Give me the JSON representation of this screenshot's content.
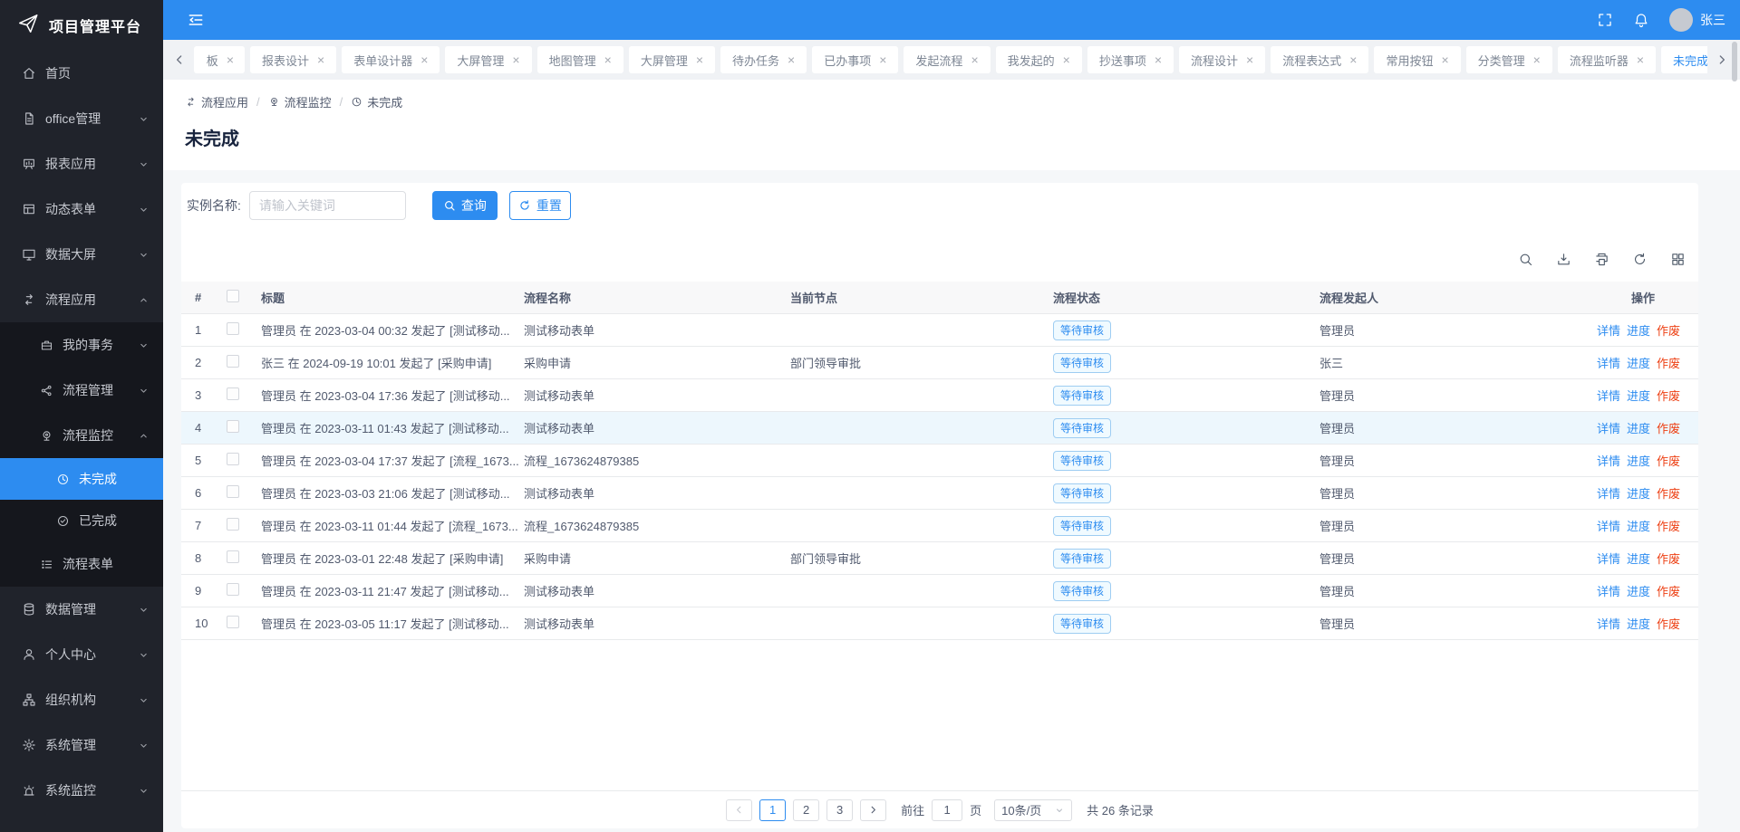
{
  "sidebar": {
    "logo": "项目管理平台",
    "items": [
      {
        "id": "home",
        "label": "首页",
        "icon": "home"
      },
      {
        "id": "office",
        "label": "office管理",
        "icon": "file",
        "chevron": "down"
      },
      {
        "id": "report-app",
        "label": "报表应用",
        "icon": "report",
        "chevron": "down"
      },
      {
        "id": "dynamic-form",
        "label": "动态表单",
        "icon": "form",
        "chevron": "down"
      },
      {
        "id": "data-screen",
        "label": "数据大屏",
        "icon": "screen",
        "chevron": "down"
      },
      {
        "id": "flow-app",
        "label": "流程应用",
        "icon": "flow",
        "chevron": "up",
        "children": [
          {
            "id": "my-tasks",
            "label": "我的事务",
            "icon": "briefcase",
            "chevron": "down"
          },
          {
            "id": "flow-manage",
            "label": "流程管理",
            "icon": "share",
            "chevron": "down"
          },
          {
            "id": "flow-monitor",
            "label": "流程监控",
            "icon": "camera",
            "chevron": "up",
            "children": [
              {
                "id": "unfinished",
                "label": "未完成",
                "icon": "clock",
                "active": true
              },
              {
                "id": "finished",
                "label": "已完成",
                "icon": "check"
              }
            ]
          },
          {
            "id": "flow-form",
            "label": "流程表单",
            "icon": "list"
          }
        ]
      },
      {
        "id": "data-manage",
        "label": "数据管理",
        "icon": "database",
        "chevron": "down"
      },
      {
        "id": "personal-center",
        "label": "个人中心",
        "icon": "user",
        "chevron": "down"
      },
      {
        "id": "organization",
        "label": "组织机构",
        "icon": "org",
        "chevron": "down"
      },
      {
        "id": "sys-manage",
        "label": "系统管理",
        "icon": "gear",
        "chevron": "down"
      },
      {
        "id": "sys-monitor",
        "label": "系统监控",
        "icon": "alarm",
        "chevron": "down"
      }
    ]
  },
  "header": {
    "username": "张三"
  },
  "tabs": {
    "items": [
      {
        "label": "板",
        "partial": true
      },
      {
        "label": "报表设计"
      },
      {
        "label": "表单设计器"
      },
      {
        "label": "大屏管理"
      },
      {
        "label": "地图管理"
      },
      {
        "label": "大屏管理"
      },
      {
        "label": "待办任务"
      },
      {
        "label": "已办事项"
      },
      {
        "label": "发起流程"
      },
      {
        "label": "我发起的"
      },
      {
        "label": "抄送事项"
      },
      {
        "label": "流程设计"
      },
      {
        "label": "流程表达式"
      },
      {
        "label": "常用按钮"
      },
      {
        "label": "分类管理"
      },
      {
        "label": "流程监听器"
      },
      {
        "label": "未完成",
        "active": true
      }
    ]
  },
  "breadcrumb": {
    "items": [
      {
        "label": "流程应用",
        "icon": "flow"
      },
      {
        "label": "流程监控",
        "icon": "camera"
      },
      {
        "label": "未完成",
        "icon": "clock"
      }
    ]
  },
  "page": {
    "title": "未完成"
  },
  "search": {
    "label": "实例名称:",
    "placeholder": "请输入关键词",
    "query_label": "查询",
    "reset_label": "重置"
  },
  "toolbar": {
    "icons": [
      "search",
      "download",
      "printer",
      "refresh",
      "grid"
    ]
  },
  "table": {
    "columns": [
      "#",
      "标题",
      "流程名称",
      "当前节点",
      "流程状态",
      "流程发起人",
      "操作"
    ],
    "action_labels": [
      "详情",
      "进度",
      "作废"
    ],
    "rows": [
      {
        "index": "1",
        "title": "管理员 在 2023-03-04 00:32 发起了 [测试移动...",
        "process": "测试移动表单",
        "node": "",
        "status": "等待审核",
        "initiator": "管理员"
      },
      {
        "index": "2",
        "title": "张三 在 2024-09-19 10:01 发起了 [采购申请]",
        "process": "采购申请",
        "node": "部门领导审批",
        "status": "等待审核",
        "initiator": "张三"
      },
      {
        "index": "3",
        "title": "管理员 在 2023-03-04 17:36 发起了 [测试移动...",
        "process": "测试移动表单",
        "node": "",
        "status": "等待审核",
        "initiator": "管理员"
      },
      {
        "index": "4",
        "title": "管理员 在 2023-03-11 01:43 发起了 [测试移动...",
        "process": "测试移动表单",
        "node": "",
        "status": "等待审核",
        "initiator": "管理员",
        "highlight": true
      },
      {
        "index": "5",
        "title": "管理员 在 2023-03-04 17:37 发起了 [流程_1673...",
        "process": "流程_1673624879385",
        "node": "",
        "status": "等待审核",
        "initiator": "管理员"
      },
      {
        "index": "6",
        "title": "管理员 在 2023-03-03 21:06 发起了 [测试移动...",
        "process": "测试移动表单",
        "node": "",
        "status": "等待审核",
        "initiator": "管理员"
      },
      {
        "index": "7",
        "title": "管理员 在 2023-03-11 01:44 发起了 [流程_1673...",
        "process": "流程_1673624879385",
        "node": "",
        "status": "等待审核",
        "initiator": "管理员"
      },
      {
        "index": "8",
        "title": "管理员 在 2023-03-01 22:48 发起了 [采购申请]",
        "process": "采购申请",
        "node": "部门领导审批",
        "status": "等待审核",
        "initiator": "管理员"
      },
      {
        "index": "9",
        "title": "管理员 在 2023-03-11 21:47 发起了 [测试移动...",
        "process": "测试移动表单",
        "node": "",
        "status": "等待审核",
        "initiator": "管理员"
      },
      {
        "index": "10",
        "title": "管理员 在 2023-03-05 11:17 发起了 [测试移动...",
        "process": "测试移动表单",
        "node": "",
        "status": "等待审核",
        "initiator": "管理员"
      }
    ]
  },
  "pagination": {
    "pages": [
      "1",
      "2",
      "3"
    ],
    "active_page": "1",
    "goto_label": "前往",
    "goto_value": "1",
    "goto_unit": "页",
    "size_value": "10条/页",
    "total_text": "共 26 条记录"
  },
  "colors": {
    "primary": "#2d8cf0",
    "danger": "#ed4014",
    "sidebar_bg": "#20232b",
    "submenu_bg": "#15171d",
    "badge_bg": "#f0faff"
  }
}
